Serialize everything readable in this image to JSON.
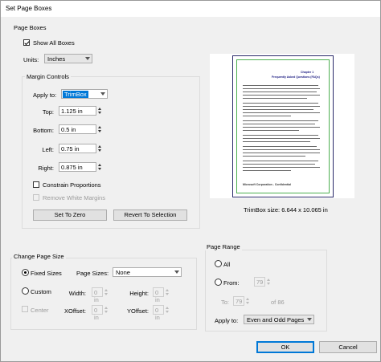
{
  "window": {
    "title": "Set Page Boxes"
  },
  "page_boxes": {
    "group_label": "Page Boxes",
    "show_all_label": "Show All Boxes",
    "units_label": "Units:",
    "units_value": "Inches"
  },
  "margins": {
    "group_label": "Margin Controls",
    "apply_to_label": "Apply to:",
    "apply_to_value": "TrimBox",
    "top_label": "Top:",
    "top_value": "1.125 in",
    "bottom_label": "Bottom:",
    "bottom_value": "0.5 in",
    "left_label": "Left:",
    "left_value": "0.75 in",
    "right_label": "Right:",
    "right_value": "0.875 in",
    "constrain_label": "Constrain Proportions",
    "remove_white_label": "Remove White Margins",
    "set_zero_label": "Set To Zero",
    "revert_label": "Revert To Selection"
  },
  "preview": {
    "size_text": "TrimBox size: 6.644 x 10.065 in",
    "doc_chapter": "Chapter 1",
    "doc_title": "Frequently Asked Questions (FAQs)",
    "doc_footer": "Microsoft Corporation - Confidential"
  },
  "page_size": {
    "group_label": "Change Page Size",
    "fixed_label": "Fixed Sizes",
    "page_sizes_label": "Page Sizes:",
    "page_sizes_value": "None",
    "custom_label": "Custom",
    "width_label": "Width:",
    "width_value": "0 in",
    "height_label": "Height:",
    "height_value": "0 in",
    "center_label": "Center",
    "xoffset_label": "XOffset:",
    "xoffset_value": "0 in",
    "yoffset_label": "YOffset:",
    "yoffset_value": "0 in"
  },
  "page_range": {
    "group_label": "Page Range",
    "all_label": "All",
    "from_label": "From:",
    "from_value": "79",
    "to_label": "To:",
    "to_value": "79",
    "of_text": "of 86",
    "apply_to_label": "Apply to:",
    "apply_to_value": "Even and Odd Pages"
  },
  "footer": {
    "ok_label": "OK",
    "cancel_label": "Cancel"
  }
}
